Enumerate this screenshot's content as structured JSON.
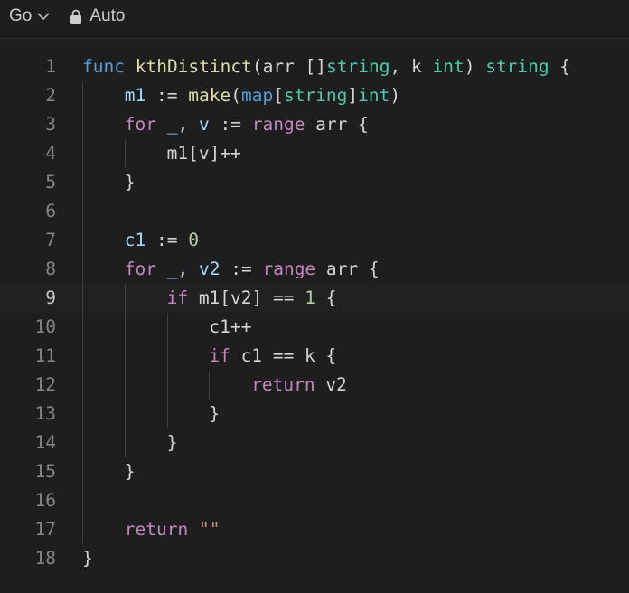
{
  "toolbar": {
    "language": "Go",
    "mode": "Auto"
  },
  "editor": {
    "current_line": 9,
    "lines": [
      {
        "n": "1",
        "indent": 0,
        "tokens": [
          [
            "func",
            "kw-blue"
          ],
          [
            " ",
            "txt"
          ],
          [
            "kthDistinct",
            "fn"
          ],
          [
            "(arr []",
            "txt"
          ],
          [
            "string",
            "type"
          ],
          [
            ", k ",
            "txt"
          ],
          [
            "int",
            "type"
          ],
          [
            ") ",
            "txt"
          ],
          [
            "string",
            "type"
          ],
          [
            " {",
            "txt"
          ]
        ]
      },
      {
        "n": "2",
        "indent": 1,
        "tokens": [
          [
            "m1",
            "var"
          ],
          [
            " := ",
            "txt"
          ],
          [
            "make",
            "fn"
          ],
          [
            "(",
            "txt"
          ],
          [
            "map",
            "kw-blue"
          ],
          [
            "[",
            "txt"
          ],
          [
            "string",
            "type"
          ],
          [
            "]",
            "txt"
          ],
          [
            "int",
            "type"
          ],
          [
            ")",
            "txt"
          ]
        ]
      },
      {
        "n": "3",
        "indent": 1,
        "tokens": [
          [
            "for",
            "ctrl"
          ],
          [
            " ",
            "txt"
          ],
          [
            "_",
            "var"
          ],
          [
            ", ",
            "txt"
          ],
          [
            "v",
            "var"
          ],
          [
            " := ",
            "txt"
          ],
          [
            "range",
            "ctrl"
          ],
          [
            " arr {",
            "txt"
          ]
        ]
      },
      {
        "n": "4",
        "indent": 2,
        "tokens": [
          [
            "m1[v]++",
            "txt"
          ]
        ]
      },
      {
        "n": "5",
        "indent": 1,
        "tokens": [
          [
            "}",
            "txt"
          ]
        ]
      },
      {
        "n": "6",
        "indent": 1,
        "tokens": []
      },
      {
        "n": "7",
        "indent": 1,
        "tokens": [
          [
            "c1",
            "var"
          ],
          [
            " := ",
            "txt"
          ],
          [
            "0",
            "num"
          ]
        ]
      },
      {
        "n": "8",
        "indent": 1,
        "tokens": [
          [
            "for",
            "ctrl"
          ],
          [
            " ",
            "txt"
          ],
          [
            "_",
            "var"
          ],
          [
            ", ",
            "txt"
          ],
          [
            "v2",
            "var"
          ],
          [
            " := ",
            "txt"
          ],
          [
            "range",
            "ctrl"
          ],
          [
            " arr {",
            "txt"
          ]
        ]
      },
      {
        "n": "9",
        "indent": 2,
        "tokens": [
          [
            "if",
            "ctrl"
          ],
          [
            " m1[v2] == ",
            "txt"
          ],
          [
            "1",
            "num"
          ],
          [
            " {",
            "txt"
          ]
        ]
      },
      {
        "n": "10",
        "indent": 3,
        "tokens": [
          [
            "c1++",
            "txt"
          ]
        ]
      },
      {
        "n": "11",
        "indent": 3,
        "tokens": [
          [
            "if",
            "ctrl"
          ],
          [
            " c1 == k {",
            "txt"
          ]
        ]
      },
      {
        "n": "12",
        "indent": 4,
        "tokens": [
          [
            "return",
            "ctrl"
          ],
          [
            " v2",
            "txt"
          ]
        ]
      },
      {
        "n": "13",
        "indent": 3,
        "tokens": [
          [
            "}",
            "txt"
          ]
        ]
      },
      {
        "n": "14",
        "indent": 2,
        "tokens": [
          [
            "}",
            "txt"
          ]
        ]
      },
      {
        "n": "15",
        "indent": 1,
        "tokens": [
          [
            "}",
            "txt"
          ]
        ]
      },
      {
        "n": "16",
        "indent": 1,
        "tokens": []
      },
      {
        "n": "17",
        "indent": 1,
        "tokens": [
          [
            "return",
            "ctrl"
          ],
          [
            " ",
            "txt"
          ],
          [
            "\"\"",
            "str"
          ]
        ]
      },
      {
        "n": "18",
        "indent": 0,
        "tokens": [
          [
            "}",
            "txt"
          ]
        ]
      }
    ]
  }
}
